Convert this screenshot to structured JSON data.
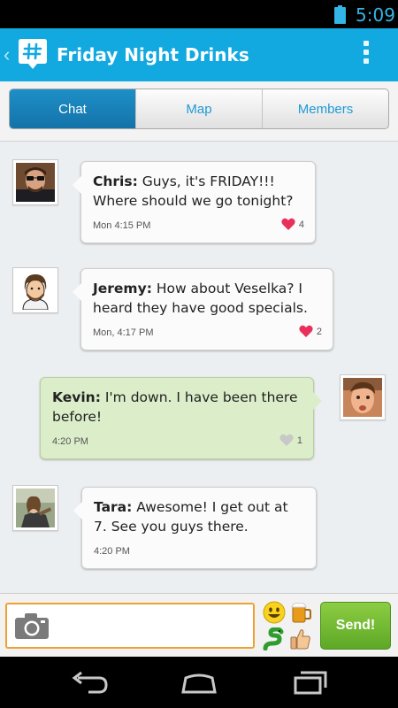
{
  "status_bar": {
    "time": "5:09"
  },
  "action_bar": {
    "title": "Friday Night Drinks"
  },
  "tabs": [
    {
      "label": "Chat",
      "active": true
    },
    {
      "label": "Map",
      "active": false
    },
    {
      "label": "Members",
      "active": false
    }
  ],
  "messages": [
    {
      "sender": "Chris:",
      "text": " Guys, it's FRIDAY!!! Where should we go tonight?",
      "time": "Mon 4:15 PM",
      "likes": "4",
      "liked": true
    },
    {
      "sender": "Jeremy:",
      "text": " How about Veselka? I heard they have good specials.",
      "time": "Mon, 4:17 PM",
      "likes": "2",
      "liked": true
    },
    {
      "sender": "Kevin:",
      "text": " I'm down. I have been there before!",
      "time": "4:20 PM",
      "likes": "1",
      "liked": false
    },
    {
      "sender": "Tara:",
      "text": " Awesome! I get out at 7. See you guys there.",
      "time": "4:20 PM",
      "likes": "",
      "liked": false
    }
  ],
  "composer": {
    "input_value": "",
    "send_label": "Send!"
  },
  "colors": {
    "action_bar": "#12a9e0",
    "accent": "#33b5e5",
    "send": "#6db52f",
    "input_border": "#f0a030",
    "liked_heart": "#e8305a",
    "unliked_heart": "#c8c8c8"
  },
  "icons": {
    "camera": "camera-icon",
    "emoji_smile": "smiley-icon",
    "emoji_beer": "beer-icon",
    "emoji_snake": "snake-icon",
    "emoji_thumbs": "thumbs-up-icon"
  }
}
